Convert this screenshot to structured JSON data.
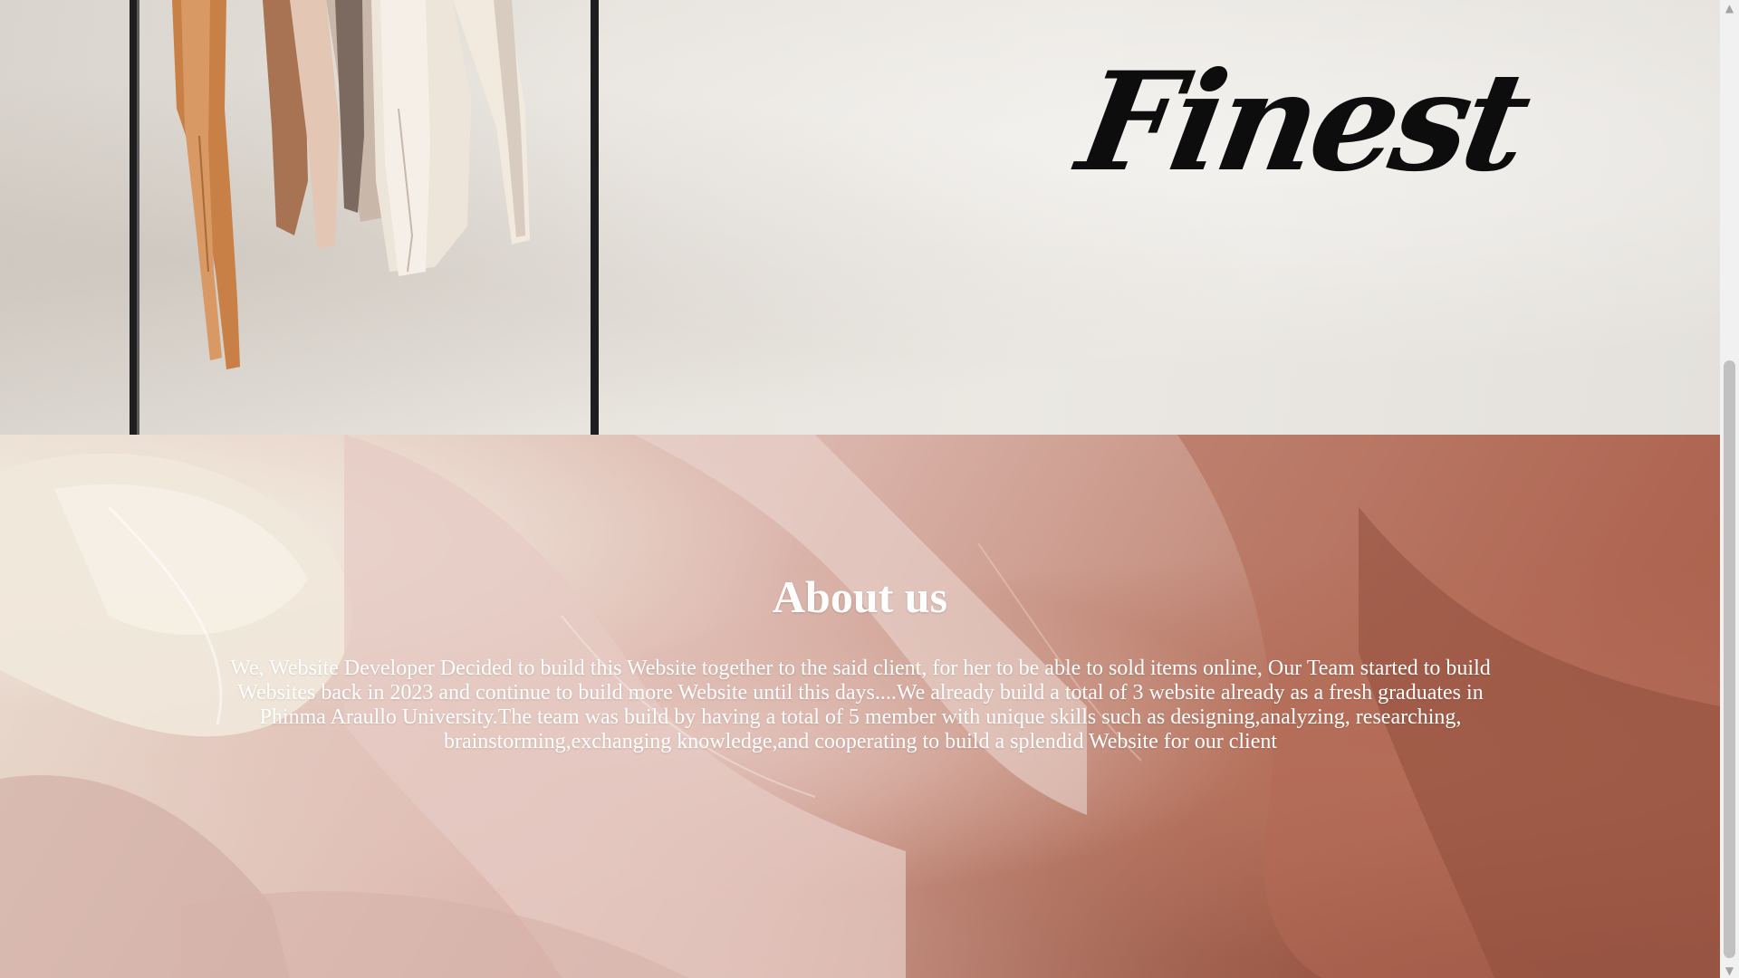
{
  "hero": {
    "logo_text": "Finest",
    "image_icon": "clothing-rack-image"
  },
  "about": {
    "title": "About us",
    "body": "We, Website Developer Decided to build this Website together to the said client, for her to be able to sold items online, Our Team started to build Websites back in 2023 and continue to build more Website until this days....We already build a total of 3 website already as a fresh graduates in Phinma Araullo University.The team was build by having a total of 5 member with unique skills such as designing,analyzing, researching, brainstorming,exchanging knowledge,and cooperating to build a splendid Website for our client",
    "background_icon": "silk-fabric-image"
  },
  "scrollbar": {
    "up_icon": "scroll-up-arrow-icon",
    "down_icon": "scroll-down-arrow-icon"
  },
  "colors": {
    "hero_bg": "#e8e4de",
    "text_light": "#ffffff",
    "logo": "#0d0d0d",
    "fabric_cream": "#f3ece1",
    "fabric_pink": "#dcb7ae",
    "fabric_rust": "#a9614d"
  }
}
